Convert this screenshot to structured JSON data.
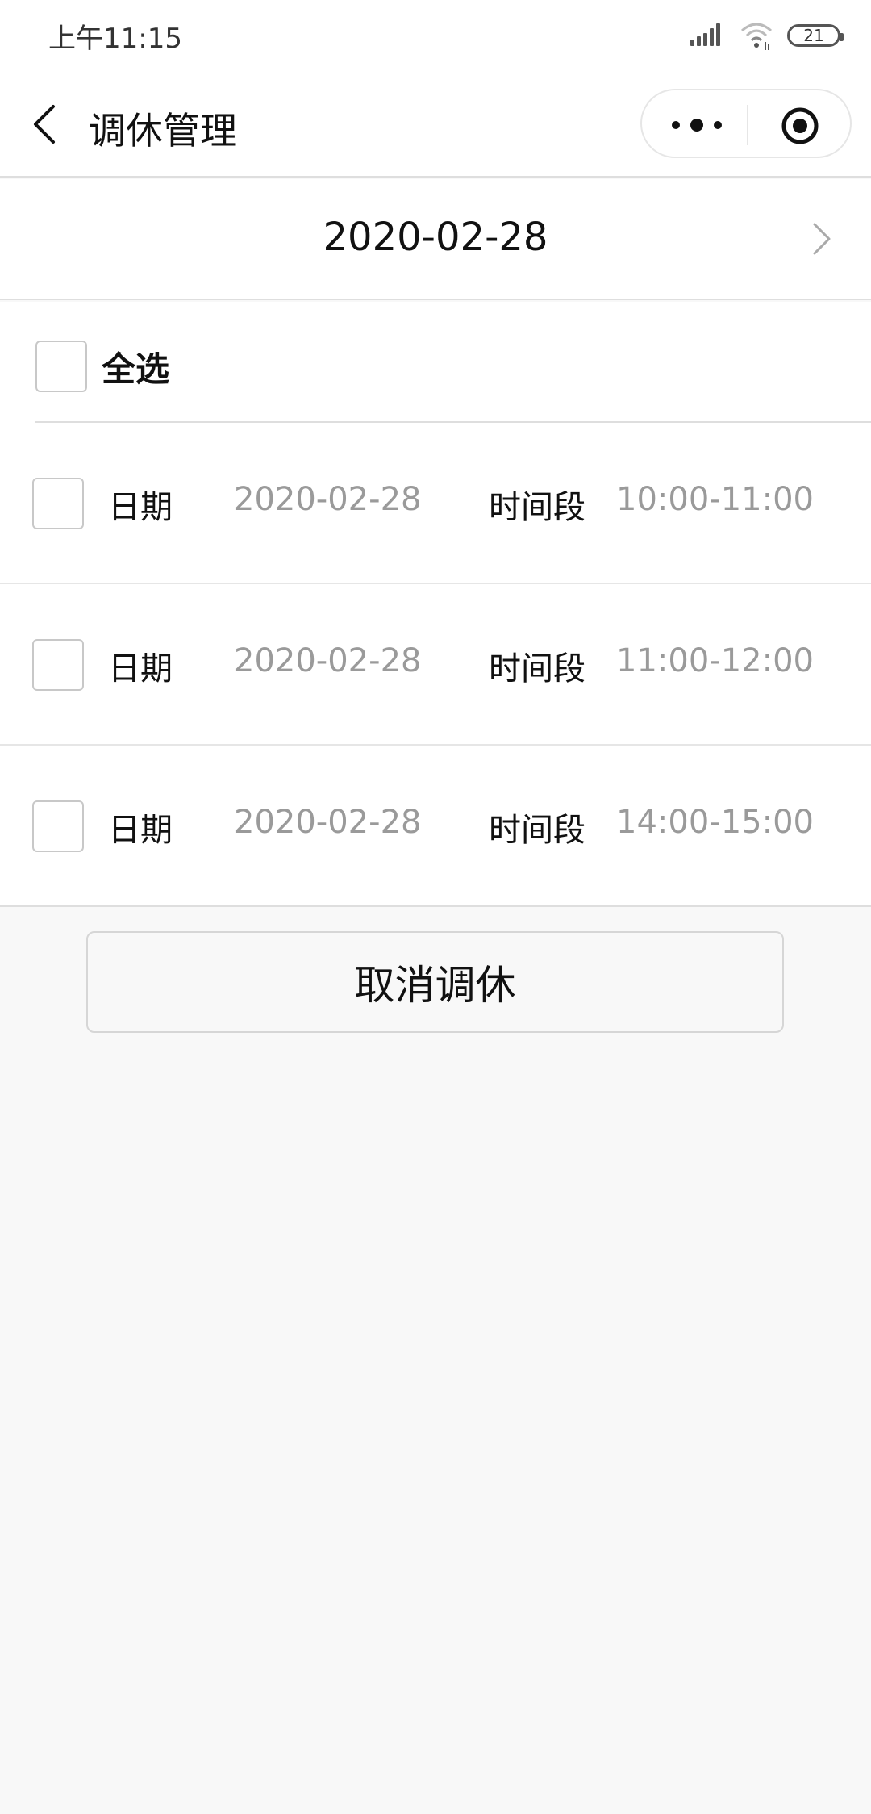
{
  "status_bar": {
    "time": "上午11:15",
    "battery": "21"
  },
  "nav": {
    "title": "调休管理"
  },
  "date_header": {
    "date": "2020-02-28"
  },
  "select_all": {
    "label": "全选"
  },
  "rows": [
    {
      "date_label": "日期",
      "date": "2020-02-28",
      "time_label": "时间段",
      "time": "10:00-11:00"
    },
    {
      "date_label": "日期",
      "date": "2020-02-28",
      "time_label": "时间段",
      "time": "11:00-12:00"
    },
    {
      "date_label": "日期",
      "date": "2020-02-28",
      "time_label": "时间段",
      "time": "14:00-15:00"
    }
  ],
  "actions": {
    "cancel_label": "取消调休"
  },
  "colors": {
    "background": "#f8f8f8",
    "surface": "#ffffff",
    "muted_text": "#9a9a9a",
    "divider": "#dedede"
  }
}
